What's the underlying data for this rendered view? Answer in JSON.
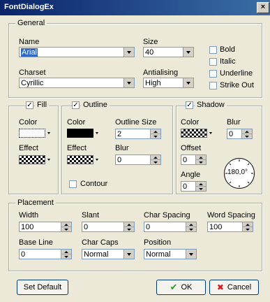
{
  "window": {
    "title": "FontDialogEx",
    "close_glyph": "×"
  },
  "general": {
    "group_label": "General",
    "name_label": "Name",
    "name_value": "Arial",
    "size_label": "Size",
    "size_value": "40",
    "charset_label": "Charset",
    "charset_value": "Cyrillic",
    "antialiasing_label": "Antialising",
    "antialiasing_value": "High",
    "bold_label": "Bold",
    "italic_label": "Italic",
    "underline_label": "Underline",
    "strikeout_label": "Strike Out"
  },
  "fill": {
    "group_label": "Fill",
    "checked": "✓",
    "color_label": "Color",
    "effect_label": "Effect"
  },
  "outline": {
    "group_label": "Outline",
    "checked": "✓",
    "color_label": "Color",
    "size_label": "Outline Size",
    "size_value": "2",
    "effect_label": "Effect",
    "blur_label": "Blur",
    "blur_value": "0",
    "contour_label": "Contour"
  },
  "shadow": {
    "group_label": "Shadow",
    "checked": "✓",
    "color_label": "Color",
    "blur_label": "Blur",
    "blur_value": "0",
    "offset_label": "Offset",
    "offset_value": "0",
    "angle_label": "Angle",
    "angle_value": "0",
    "dial_value": "180,0°"
  },
  "placement": {
    "group_label": "Placement",
    "width_label": "Width",
    "width_value": "100",
    "slant_label": "Slant",
    "slant_value": "0",
    "char_spacing_label": "Char Spacing",
    "char_spacing_value": "0",
    "word_spacing_label": "Word Spacing",
    "word_spacing_value": "100",
    "base_line_label": "Base Line",
    "base_line_value": "0",
    "char_caps_label": "Char Caps",
    "char_caps_value": "Normal",
    "position_label": "Position",
    "position_value": "Normal"
  },
  "buttons": {
    "set_default": "Set Default",
    "ok": "OK",
    "cancel": "Cancel",
    "ok_glyph": "✔",
    "cancel_glyph": "✖"
  },
  "colors": {
    "ok_icon": "#2a9a2a",
    "cancel_icon": "#d02020",
    "selection": "#316ac5"
  }
}
